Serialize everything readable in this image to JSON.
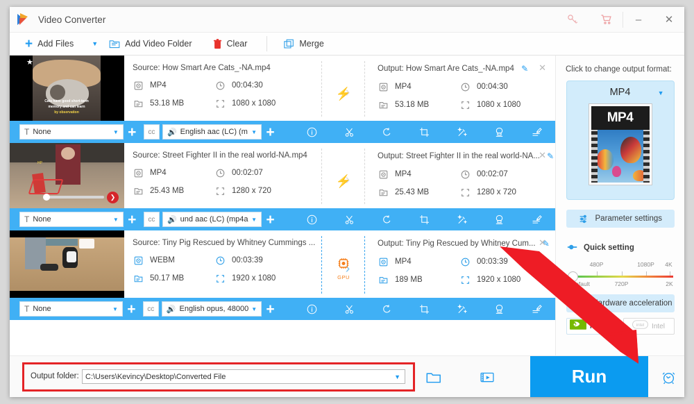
{
  "window": {
    "title": "Video Converter",
    "minimize": "–",
    "close": "✕",
    "icons": {
      "key": "key-icon",
      "cart": "cart-icon",
      "logo": "app-logo"
    }
  },
  "toolbar": {
    "add_files": "Add Files",
    "add_files_caret": "▼",
    "add_video_folder": "Add Video Folder",
    "clear": "Clear",
    "merge": "Merge"
  },
  "files": [
    {
      "source_label": "Source: How Smart Are Cats_-NA.mp4",
      "source_format": "MP4",
      "source_duration": "00:04:30",
      "source_size": "53.18 MB",
      "source_resolution": "1080 x 1080",
      "output_label": "Output: How Smart Are Cats_-NA.mp4",
      "output_format": "MP4",
      "output_duration": "00:04:30",
      "output_size": "53.18 MB",
      "output_resolution": "1080 x 1080",
      "accel_badge": "bolt",
      "selected": false,
      "subtitle": "None",
      "audio": "English aac (LC) (m",
      "thumb_caption_1": "Cats have good short-term",
      "thumb_caption_2": "memory and can learn",
      "thumb_caption_3": "by observation"
    },
    {
      "source_label": "Source: Street Fighter II in the real world-NA.mp4",
      "source_format": "MP4",
      "source_duration": "00:02:07",
      "source_size": "25.43 MB",
      "source_resolution": "1280 x 720",
      "output_label": "Output: Street Fighter II in the real world-NA...",
      "output_format": "MP4",
      "output_duration": "00:02:07",
      "output_size": "25.43 MB",
      "output_resolution": "1280 x 720",
      "accel_badge": "bolt",
      "selected": false,
      "subtitle": "None",
      "audio": "und aac (LC) (mp4a",
      "thumb_caption_1": "",
      "thumb_caption_2": "",
      "thumb_caption_3": ""
    },
    {
      "source_label": "Source: Tiny Pig Rescued by Whitney Cummings ...",
      "source_format": "WEBM",
      "source_duration": "00:03:39",
      "source_size": "50.17 MB",
      "source_resolution": "1920 x 1080",
      "output_label": "Output: Tiny Pig Rescued by Whitney Cum...",
      "output_format": "MP4",
      "output_duration": "00:03:39",
      "output_size": "189 MB",
      "output_resolution": "1920 x 1080",
      "accel_badge": "GPU",
      "selected": true,
      "subtitle": "None",
      "audio": "English opus, 48000",
      "thumb_caption_1": "",
      "thumb_caption_2": "",
      "thumb_caption_3": ""
    }
  ],
  "row_tools": [
    {
      "name": "info-icon",
      "title": "Information"
    },
    {
      "name": "cut-icon",
      "title": "Cut"
    },
    {
      "name": "rotate-icon",
      "title": "Rotate"
    },
    {
      "name": "crop-icon",
      "title": "Crop"
    },
    {
      "name": "effect-icon",
      "title": "Effect"
    },
    {
      "name": "watermark-icon",
      "title": "Watermark"
    },
    {
      "name": "subtitle-icon",
      "title": "Subtitle"
    }
  ],
  "sidebar": {
    "format_hint": "Click to change output format:",
    "format_name": "MP4",
    "format_caret": "▼",
    "format_thumb_text": "MP4",
    "parameter_settings": "Parameter settings",
    "quick_setting": "Quick setting",
    "slider_labels_top": [
      "480P",
      "1080P",
      "4K"
    ],
    "slider_labels_bottom": [
      "Default",
      "720P",
      "2K"
    ],
    "slider_value": "Default",
    "hardware_acceleration": "Hardware acceleration",
    "accel_nvidia": "NVIDIA",
    "accel_intel": "Intel",
    "accel_nvidia_enabled": true,
    "accel_intel_enabled": false
  },
  "bottom": {
    "output_folder_label": "Output folder:",
    "output_folder_value": "C:\\Users\\Kevincy\\Desktop\\Converted File",
    "output_folder_caret": "▼",
    "run_label": "Run",
    "browse_icon": "folder-icon",
    "snapshot_icon": "media-info-icon",
    "schedule_icon": "alarm-clock-icon"
  },
  "colors": {
    "accent": "#1e9bf0",
    "blue_bar": "#40b0f5",
    "run_button": "#0b9bf0",
    "orange": "#f5801e",
    "highlight_red": "#e42326"
  }
}
